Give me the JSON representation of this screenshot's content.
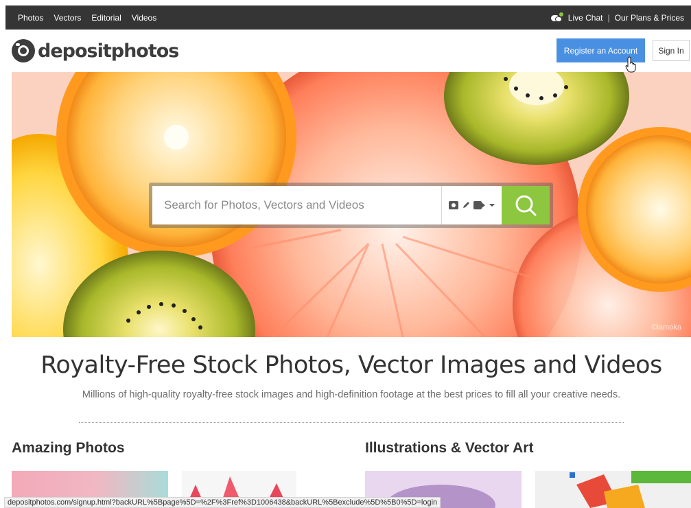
{
  "topnav": {
    "items": [
      "Photos",
      "Vectors",
      "Editorial",
      "Videos"
    ],
    "live_chat": "Live Chat",
    "separator": "|",
    "plans": "Our Plans & Prices"
  },
  "header": {
    "logo_text": "depositphotos",
    "register_label": "Register an Account",
    "signin_label": "Sign In"
  },
  "hero": {
    "search_placeholder": "Search for Photos, Vectors and Videos",
    "watermark": "©lamoka"
  },
  "main": {
    "headline": "Royalty-Free Stock Photos, Vector Images and Videos",
    "subline": "Millions of high-quality royalty-free stock images and high-definition footage at the best prices to fill all your creative needs.",
    "sections": [
      "Amazing Photos",
      "Illustrations & Vector Art"
    ]
  },
  "status_bar": {
    "url": "depositphotos.com/signup.html?backURL%5Bpage%5D=%2F%3Fref%3D1006438&backURL%5Bexclude%5D%5B0%5D=login"
  },
  "colors": {
    "topbar": "#353535",
    "register_button": "#4a90e2",
    "search_button": "#8dc63f",
    "live_chat_dot": "#8dc63f"
  },
  "icons": [
    "live-chat-icon",
    "logo-camera-icon",
    "camera-icon",
    "pen-icon",
    "video-icon",
    "chevron-down-icon",
    "search-icon",
    "hand-cursor-icon"
  ]
}
